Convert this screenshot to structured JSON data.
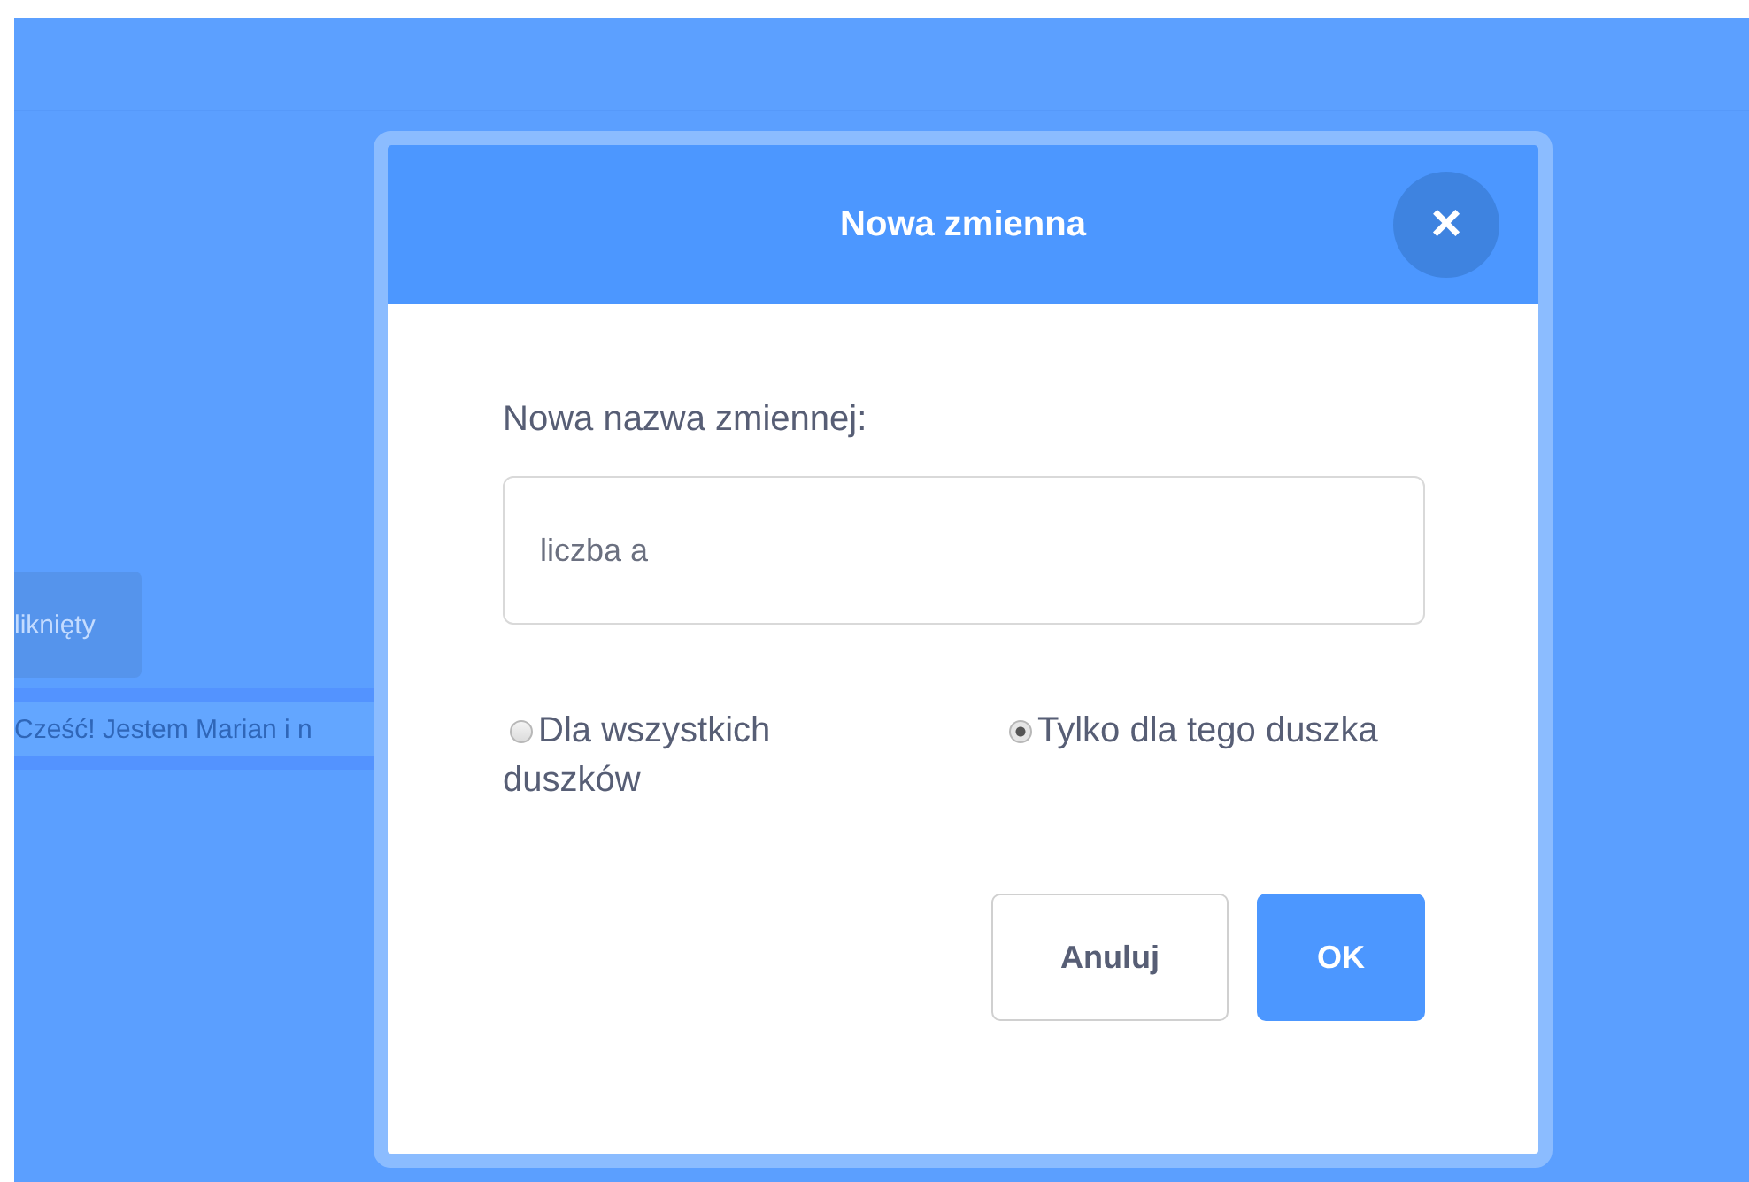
{
  "background": {
    "block_label": "liknięty",
    "speech_text": "Cześć! Jestem Marian i n"
  },
  "dialog": {
    "title": "Nowa zmienna",
    "close": "×",
    "prompt": "Nowa nazwa zmiennej:",
    "name_value": "liczba a",
    "scope_options": [
      {
        "label": "Dla wszystkich duszków",
        "selected": false
      },
      {
        "label": "Tylko dla tego duszka",
        "selected": true
      }
    ],
    "buttons": [
      {
        "label": "Anuluj",
        "kind": "secondary"
      },
      {
        "label": "OK",
        "kind": "primary"
      }
    ]
  }
}
